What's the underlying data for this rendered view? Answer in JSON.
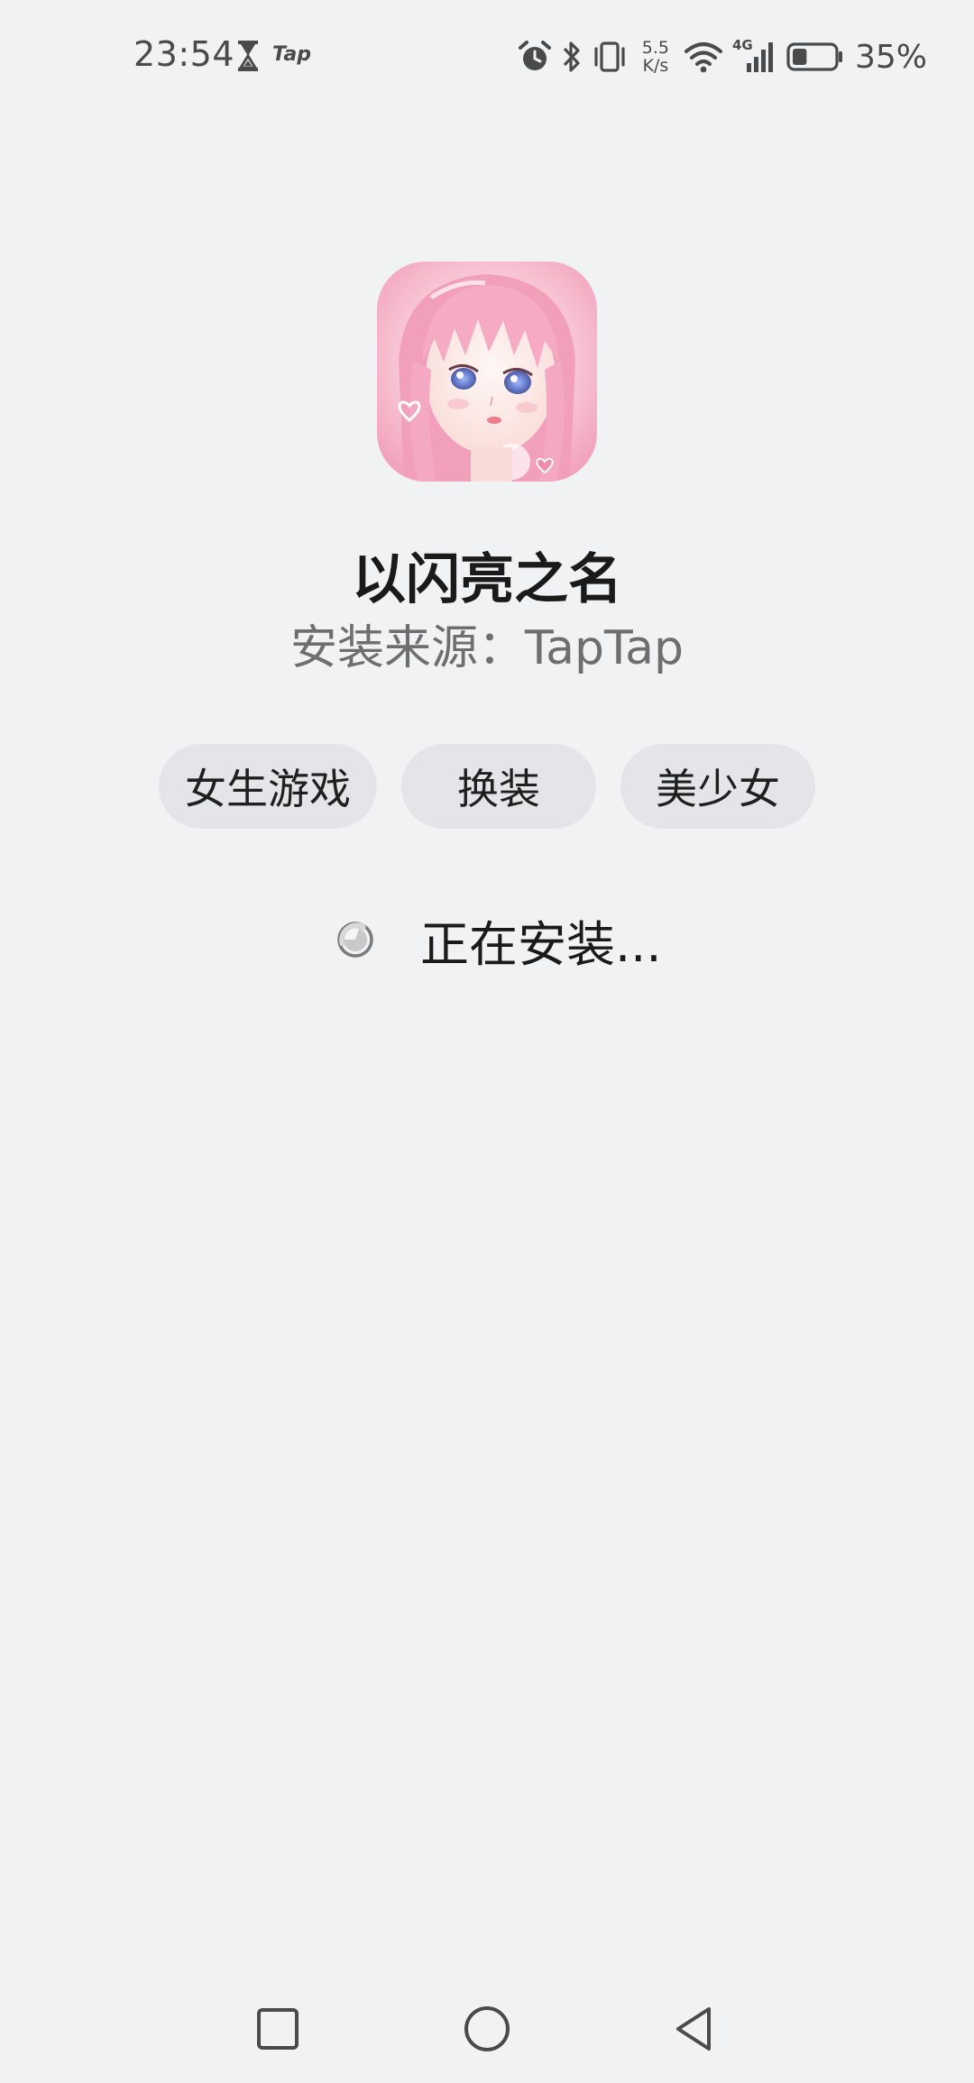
{
  "status_bar": {
    "time": "23:54",
    "tap_label": "Tap",
    "net_speed_value": "5.5",
    "net_speed_unit": "K/s",
    "network_type": "4G",
    "battery_percent": "35%",
    "battery_level": 0.35,
    "icons": [
      "hourglass-icon",
      "alarm-icon",
      "bluetooth-icon",
      "vibrate-icon",
      "wifi-icon",
      "cellular-signal-icon",
      "battery-icon"
    ]
  },
  "app": {
    "name": "以闪亮之名",
    "install_source": "安装来源：TapTap",
    "icon": "app-icon-anime-girl",
    "tags": [
      "女生游戏",
      "换装",
      "美少女"
    ]
  },
  "install": {
    "status_text": "正在安装..."
  },
  "nav_bar": {
    "icons": [
      "recent-apps-icon",
      "home-icon",
      "back-icon"
    ]
  },
  "colors": {
    "background": "#f1f2f4",
    "tag_background": "#e4e5e8",
    "secondary_text": "#6e6e6e",
    "icon_pink": "#f4a7c0"
  }
}
